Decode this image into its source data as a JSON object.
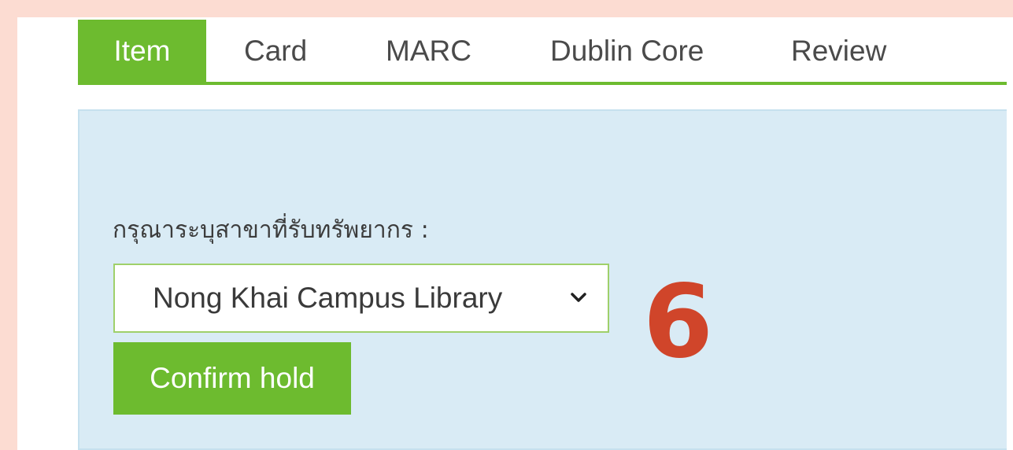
{
  "tabs": [
    {
      "label": "Item",
      "active": true
    },
    {
      "label": "Card",
      "active": false
    },
    {
      "label": "MARC",
      "active": false
    },
    {
      "label": "Dublin Core",
      "active": false
    },
    {
      "label": "Review",
      "active": false
    }
  ],
  "hold_form": {
    "prompt": "กรุณาระบุสาขาที่รับทรัพยากร :",
    "branch_select": {
      "selected": "Nong Khai Campus Library"
    },
    "confirm_label": "Confirm hold"
  },
  "annotation": {
    "step_number": "6"
  },
  "colors": {
    "accent_green": "#6dbb2f",
    "panel_blue": "#d9ebf5",
    "annotation_red": "#d0452a",
    "frame_pink": "#fcdcd2"
  },
  "icons": {
    "select_arrow": "chevron-down-icon"
  }
}
